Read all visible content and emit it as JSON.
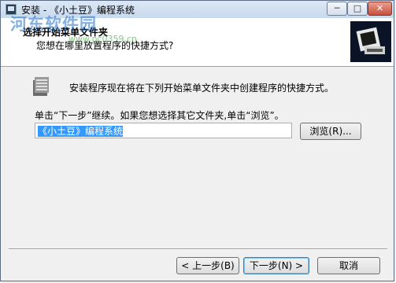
{
  "window": {
    "title": "安装 - 《小土豆》编程系统"
  },
  "titlebar": {
    "minimize": "─",
    "maximize": "□",
    "close": "✕"
  },
  "header": {
    "title": "选择开始菜单文件夹",
    "subtitle": "您想在哪里放置程序的快捷方式?",
    "watermark": "河东软件园",
    "watermark_url": "www.pc0359.cn"
  },
  "main": {
    "info": "安装程序现在将在下列开始菜单文件夹中创建程序的快捷方式。",
    "hint": "单击“下一步”继续。如果您想选择其它文件夹,单击“浏览”。",
    "folder_value": "《小土豆》编程系统",
    "browse_label": "浏览(R)..."
  },
  "footer": {
    "back_label": "< 上一步(B)",
    "next_label": "下一步(N) >",
    "cancel_label": "取消"
  }
}
